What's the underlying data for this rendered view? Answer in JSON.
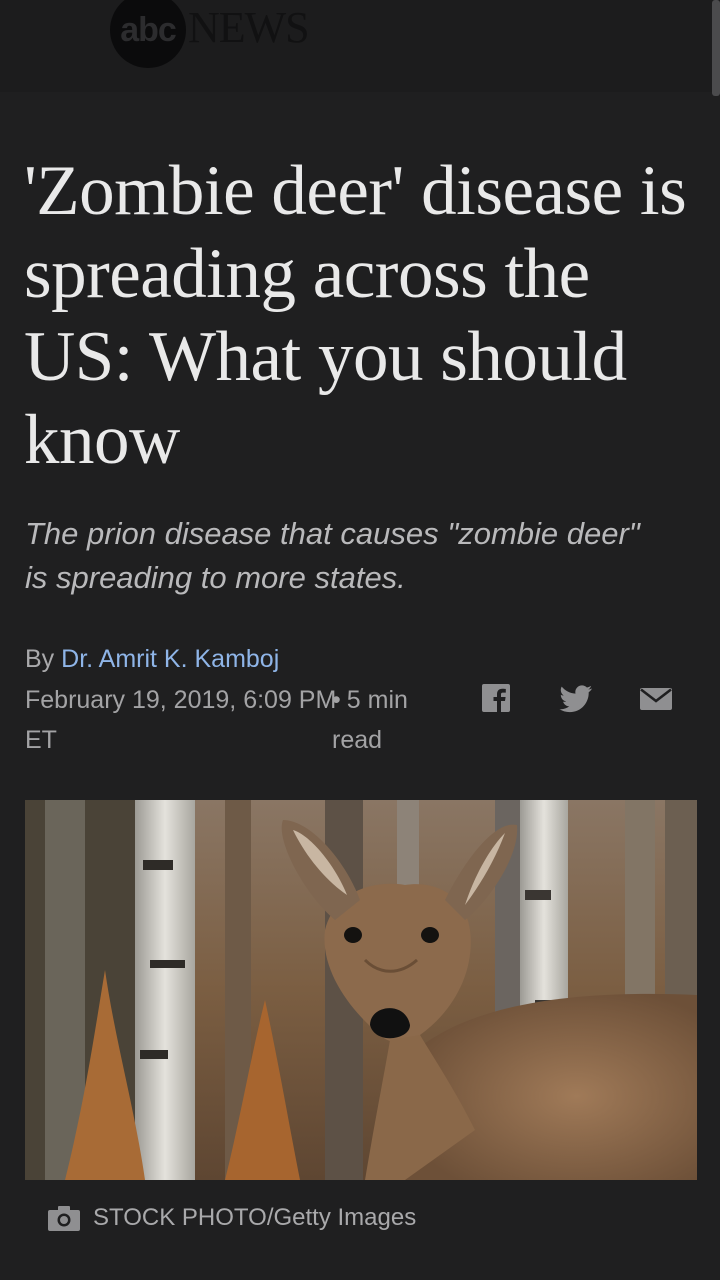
{
  "header": {
    "logo_abc": "abc",
    "logo_news": "NEWS"
  },
  "article": {
    "headline": "'Zombie deer' disease is spreading across the US: What you should know",
    "subheadline": "The prion disease that causes \"zombie deer\" is spreading to more states.",
    "byline_prefix": "By",
    "author": "Dr. Amrit K. Kamboj",
    "date": "February 19, 2019, 6:09 PM ET",
    "read_time": "5 min",
    "read_word": "read"
  },
  "share": {
    "icons": [
      "facebook-icon",
      "twitter-icon",
      "email-icon"
    ]
  },
  "photo": {
    "subject": "white-tailed deer in birch forest",
    "credit": "STOCK PHOTO/Getty Images"
  },
  "colors": {
    "background": "#1f1f20",
    "headline": "#e9e9e9",
    "author_link": "#8fb5e8",
    "meta_text": "#a3a3a5"
  }
}
